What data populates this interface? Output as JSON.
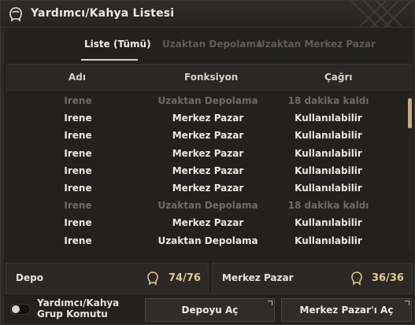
{
  "window": {
    "title": "Yardımcı/Kahya Listesi"
  },
  "tabs": [
    {
      "label": "Liste (Tümü)",
      "active": true
    },
    {
      "label": "Uzaktan Depolama",
      "active": false
    },
    {
      "label": "Uzaktan Merkez Pazar",
      "active": false
    }
  ],
  "columns": {
    "name": "Adı",
    "function": "Fonksiyon",
    "call": "Çağrı"
  },
  "rows": [
    {
      "name": "Irene",
      "function": "Uzaktan Depolama",
      "call": "18 dakika kaldı",
      "available": false
    },
    {
      "name": "Irene",
      "function": "Merkez Pazar",
      "call": "Kullanılabilir",
      "available": true
    },
    {
      "name": "Irene",
      "function": "Merkez Pazar",
      "call": "Kullanılabilir",
      "available": true
    },
    {
      "name": "Irene",
      "function": "Merkez Pazar",
      "call": "Kullanılabilir",
      "available": true
    },
    {
      "name": "Irene",
      "function": "Merkez Pazar",
      "call": "Kullanılabilir",
      "available": true
    },
    {
      "name": "Irene",
      "function": "Merkez Pazar",
      "call": "Kullanılabilir",
      "available": true
    },
    {
      "name": "Irene",
      "function": "Uzaktan Depolama",
      "call": "18 dakika kaldı",
      "available": false
    },
    {
      "name": "Irene",
      "function": "Merkez Pazar",
      "call": "Kullanılabilir",
      "available": true
    },
    {
      "name": "Irene",
      "function": "Uzaktan Depolama",
      "call": "Kullanılabilir",
      "available": true
    }
  ],
  "panels": {
    "depo": {
      "label": "Depo",
      "count": "74/76",
      "icon": "helper-head-icon"
    },
    "market": {
      "label": "Merkez Pazar",
      "count": "36/36",
      "icon": "helper-head-icon"
    }
  },
  "footer": {
    "toggle_line1": "Yardımcı/Kahya",
    "toggle_line2": "Grup Komutu",
    "open_depot": "Depoyu Aç",
    "open_market": "Merkez Pazar'ı Aç"
  },
  "colors": {
    "accent": "#e7c98f",
    "dim_text": "#6f6b65",
    "bright_text": "#ece7de"
  }
}
